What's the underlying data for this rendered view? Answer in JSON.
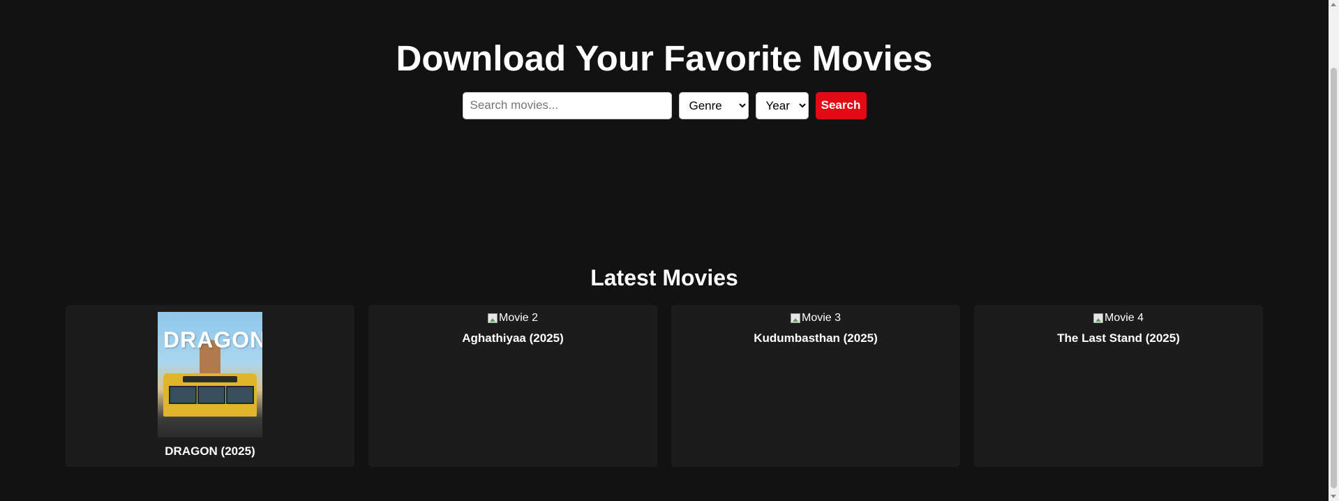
{
  "hero": {
    "title": "Download Your Favorite Movies"
  },
  "search": {
    "placeholder": "Search movies...",
    "value": "",
    "genre_selected": "Genre",
    "year_selected": "Year",
    "button_label": "Search"
  },
  "latest": {
    "title": "Latest Movies",
    "movies": [
      {
        "alt": "Movie 1",
        "name": "DRAGON (2025)",
        "poster_title": "DRAGON",
        "image_loaded": true
      },
      {
        "alt": "Movie 2",
        "name": "Aghathiyaa (2025)",
        "image_loaded": false
      },
      {
        "alt": "Movie 3",
        "name": "Kudumbasthan (2025)",
        "image_loaded": false
      },
      {
        "alt": "Movie 4",
        "name": "The Last Stand (2025)",
        "image_loaded": false
      }
    ]
  },
  "colors": {
    "background": "#121212",
    "card": "#1c1c1c",
    "accent": "#e50914"
  }
}
